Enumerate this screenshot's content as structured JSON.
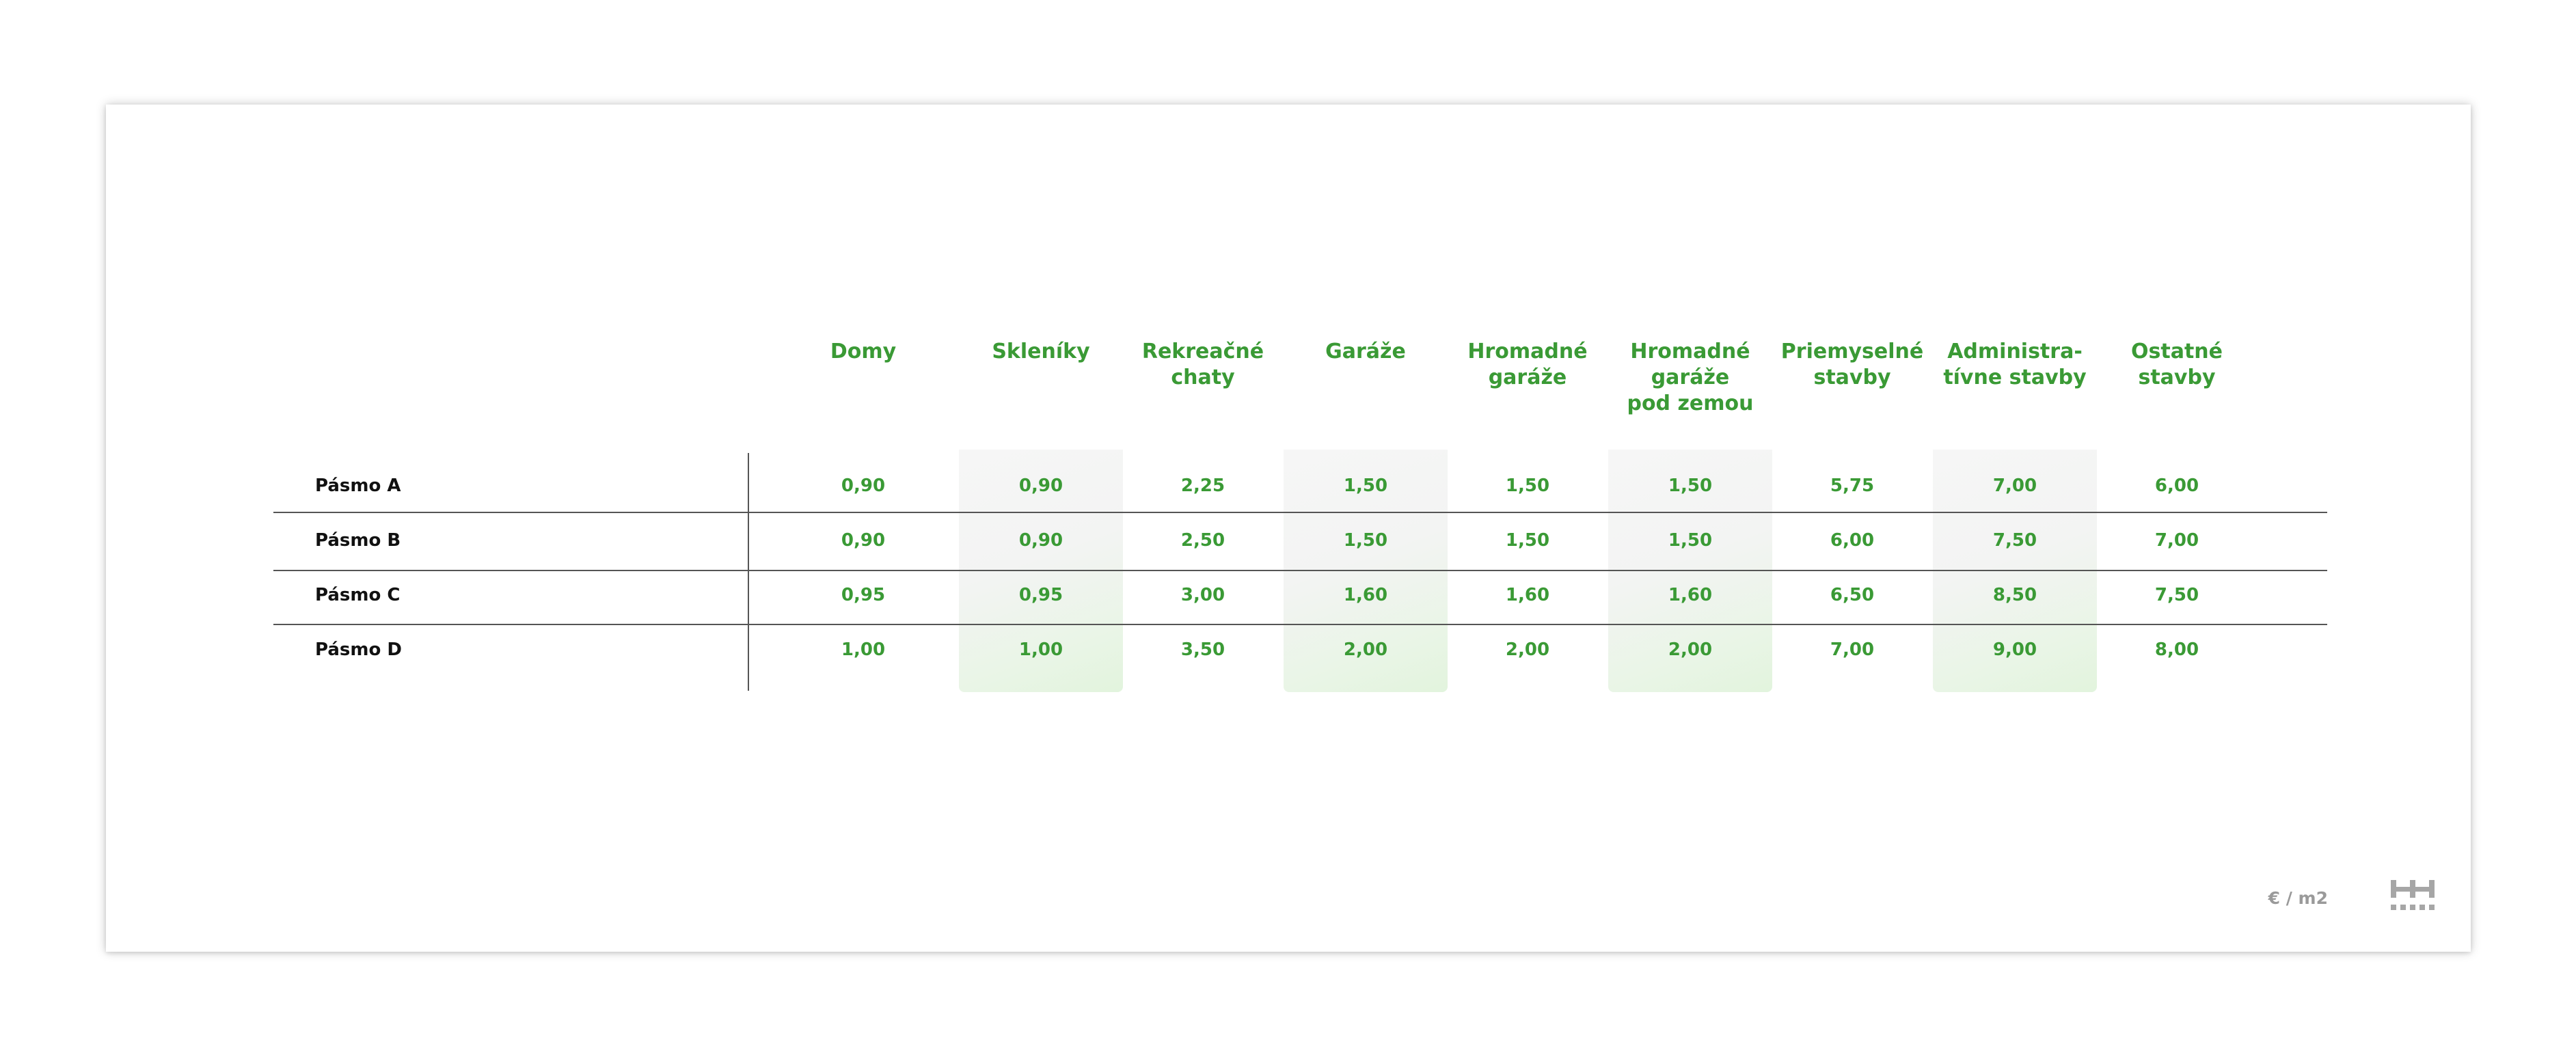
{
  "chart_data": {
    "type": "table",
    "columns": [
      "Domy",
      "Skleníky",
      "Rekreačné\nchaty",
      "Garáže",
      "Hromadné\ngaráže",
      "Hromadné\ngaráže\npod zemou",
      "Priemyselné\nstavby",
      "Administra-\ntívne stavby",
      "Ostatné\nstavby"
    ],
    "rows": [
      {
        "label": "Pásmo A",
        "values": [
          "0,90",
          "0,90",
          "2,25",
          "1,50",
          "1,50",
          "1,50",
          "5,75",
          "7,00",
          "6,00"
        ]
      },
      {
        "label": "Pásmo B",
        "values": [
          "0,90",
          "0,90",
          "2,50",
          "1,50",
          "1,50",
          "1,50",
          "6,00",
          "7,50",
          "7,00"
        ]
      },
      {
        "label": "Pásmo C",
        "values": [
          "0,95",
          "0,95",
          "3,00",
          "1,60",
          "1,60",
          "1,60",
          "6,50",
          "8,50",
          "7,50"
        ]
      },
      {
        "label": "Pásmo D",
        "values": [
          "1,00",
          "1,00",
          "3,50",
          "2,00",
          "2,00",
          "2,00",
          "7,00",
          "9,00",
          "8,00"
        ]
      }
    ],
    "unit": "€ / m2",
    "highlighted_columns": [
      1,
      3,
      5,
      7
    ],
    "colors": {
      "accent": "#3a9a35",
      "row_label": "#111111",
      "unit_text": "#9a9a9a",
      "rules": "#555555"
    }
  },
  "logo": {
    "icon": "grid-logo-icon"
  }
}
